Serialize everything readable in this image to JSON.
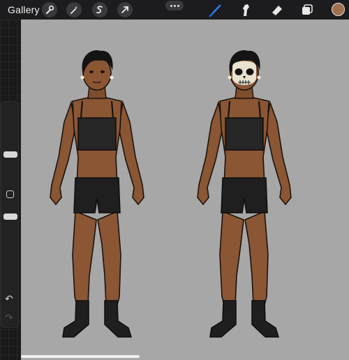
{
  "toolbar": {
    "gallery_label": "Gallery",
    "left_tools": [
      "wrench-icon",
      "magic-wand-icon",
      "selection-icon",
      "transform-arrow-icon"
    ],
    "right_tools": [
      "brush-icon",
      "smudge-icon",
      "eraser-icon",
      "layers-icon"
    ],
    "active_tool": "brush",
    "active_tool_color": "#2f7bf5",
    "current_color": "#a0704a"
  },
  "sidebar": {
    "brush_size_level": 0.25,
    "opacity_level": 0.55
  },
  "canvas": {
    "background": "#a7a7a7",
    "figures": [
      "figure-plain",
      "figure-skull-face-paint"
    ]
  }
}
